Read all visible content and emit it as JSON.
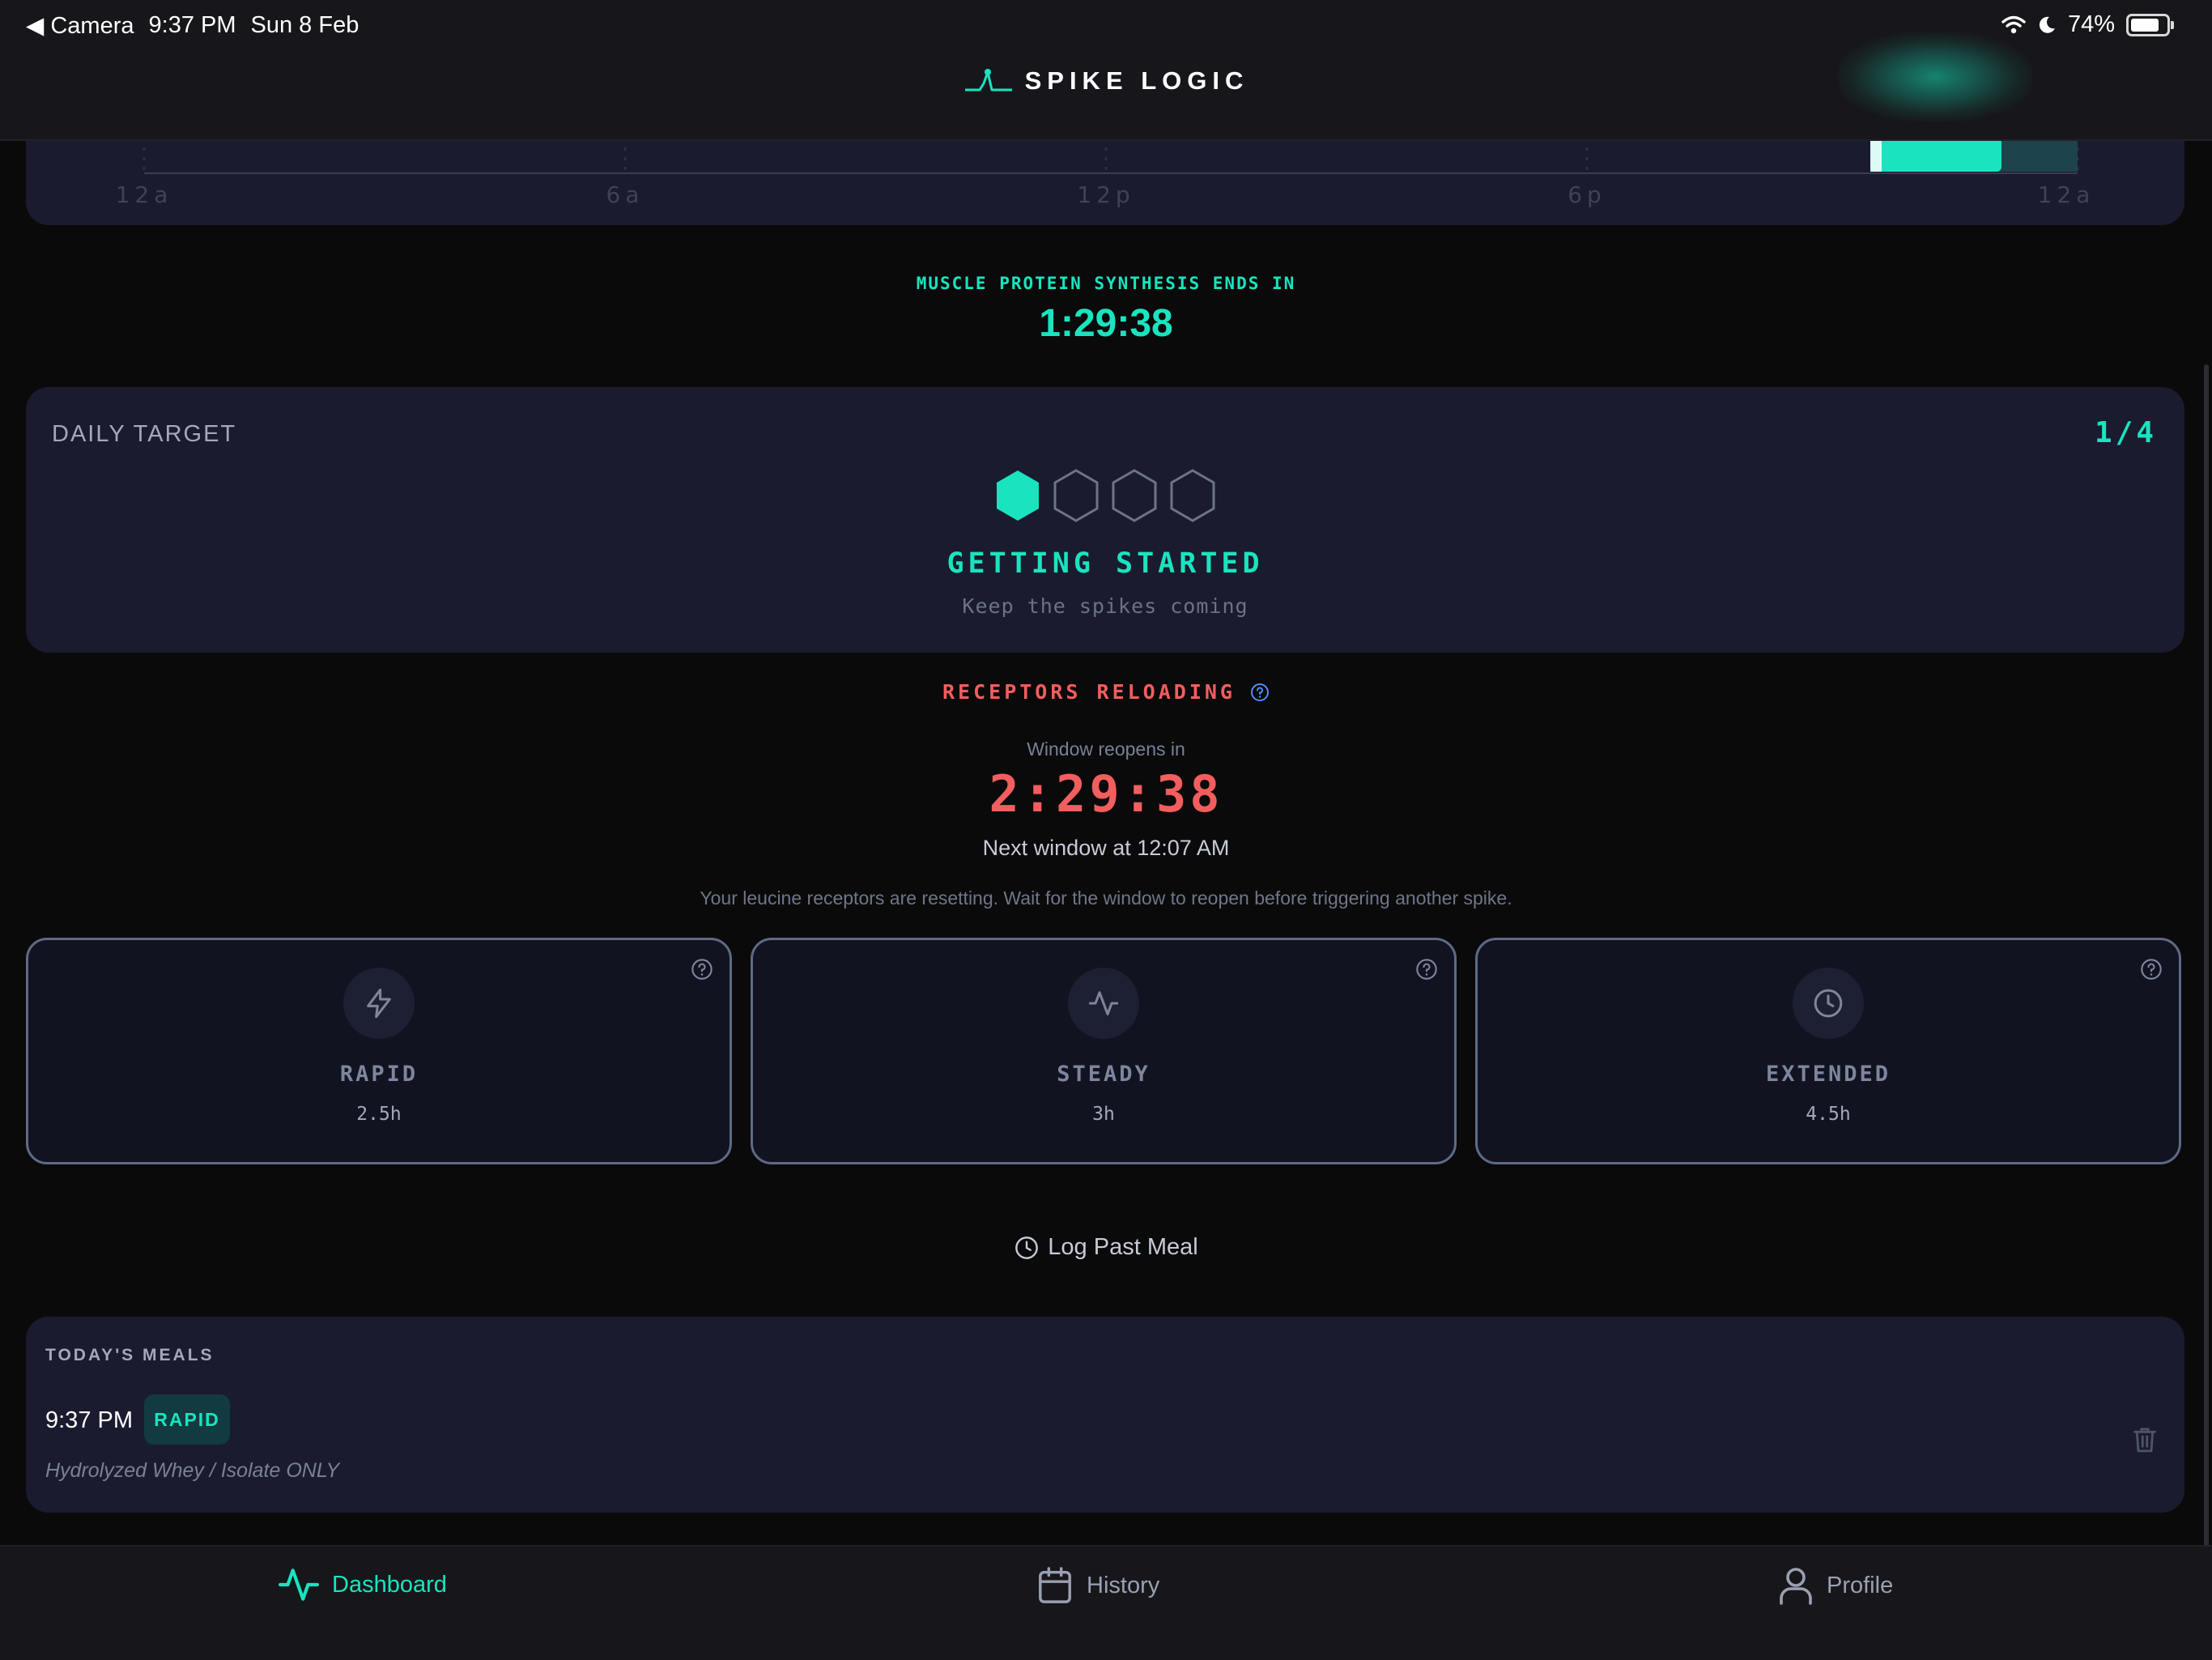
{
  "status_bar": {
    "back_label": "◀ Camera",
    "time": "9:37 PM",
    "date": "Sun 8 Feb",
    "battery": "74%"
  },
  "header": {
    "brand": "SPIKE LOGIC"
  },
  "chart": {
    "x_tick_labels": [
      "12a",
      "6a",
      "12p",
      "6p",
      "12a"
    ]
  },
  "mps": {
    "label": "MUSCLE PROTEIN SYNTHESIS ENDS IN",
    "countdown": "1:29:38"
  },
  "daily_target": {
    "title": "DAILY TARGET",
    "count": "1/4",
    "completed": 1,
    "total": 4,
    "status": "GETTING STARTED",
    "subtitle": "Keep the spikes coming"
  },
  "receptors": {
    "title": "RECEPTORS RELOADING",
    "reopen_label": "Window reopens in",
    "countdown": "2:29:38",
    "next_window": "Next window at 12:07 AM",
    "note": "Your leucine receptors are resetting. Wait for the window to reopen before triggering another spike."
  },
  "types": [
    {
      "name": "RAPID",
      "duration": "2.5h",
      "icon": "lightning-icon"
    },
    {
      "name": "STEADY",
      "duration": "3h",
      "icon": "pulse-icon"
    },
    {
      "name": "EXTENDED",
      "duration": "4.5h",
      "icon": "clock-icon"
    }
  ],
  "log_past": {
    "label": "Log Past Meal"
  },
  "meals": {
    "title": "TODAY'S MEALS",
    "items": [
      {
        "time": "9:37 PM",
        "badge": "RAPID",
        "description": "Hydrolyzed Whey / Isolate ONLY"
      }
    ]
  },
  "nav": {
    "items": [
      {
        "label": "Dashboard",
        "active": true
      },
      {
        "label": "History",
        "active": false
      },
      {
        "label": "Profile",
        "active": false
      }
    ]
  },
  "colors": {
    "accent": "#19e4bf",
    "warning": "#f25e5e",
    "card": "#1a1b2e",
    "background": "#0a0a0b"
  }
}
